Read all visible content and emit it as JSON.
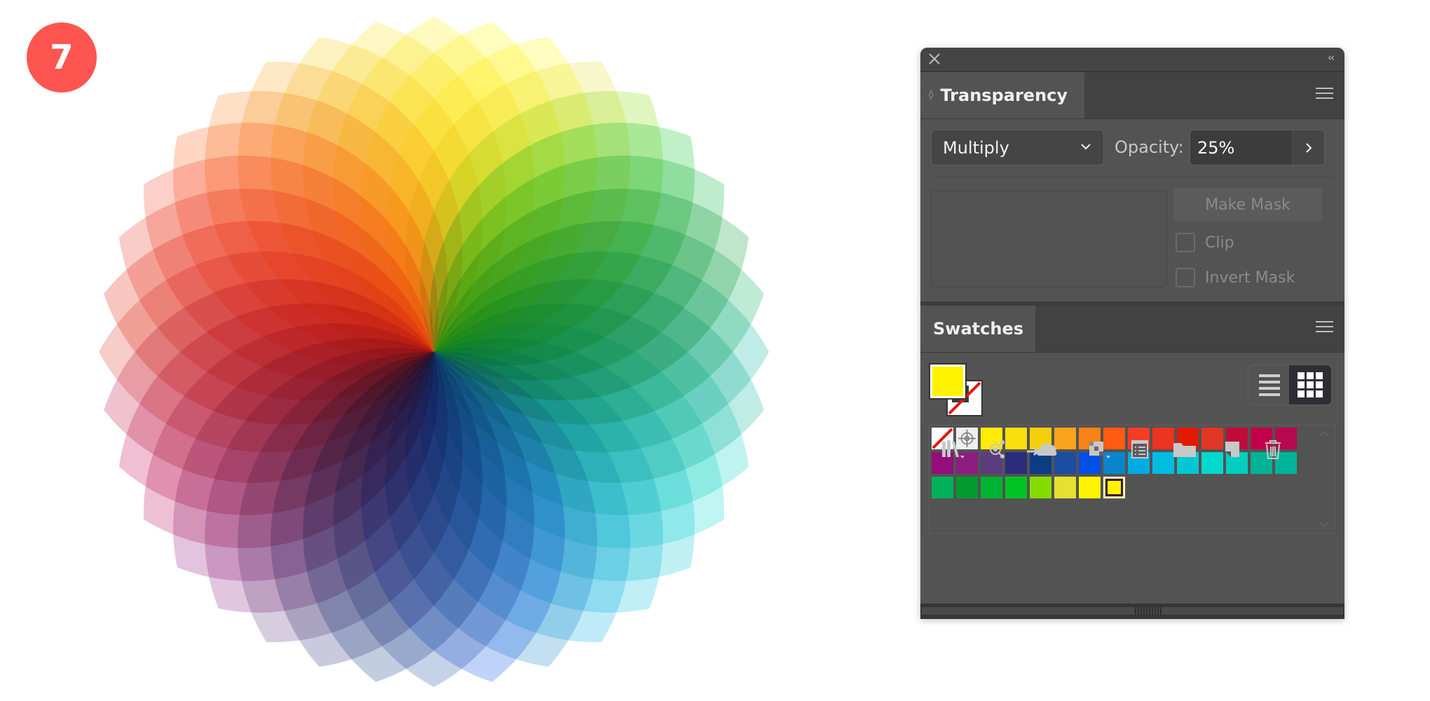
{
  "step_badge": {
    "number": "7",
    "color": "#fe5551"
  },
  "wheel": {
    "petal_count": 36,
    "blend_mode": "multiply",
    "opacity": 0.25
  },
  "panel": {
    "close_icon": "close-icon",
    "collapse_icon": "double-chevron-left-icon",
    "transparency": {
      "tab_label": "Transparency",
      "blend_mode": "Multiply",
      "opacity_label": "Opacity:",
      "opacity_value": "25%",
      "make_mask_label": "Make Mask",
      "clip_label": "Clip",
      "clip_checked": false,
      "invert_mask_label": "Invert Mask",
      "invert_mask_checked": false
    },
    "swatches": {
      "tab_label": "Swatches",
      "fill_color": "#fff200",
      "stroke": "none",
      "view_mode": "grid",
      "items": [
        {
          "type": "none",
          "name": "[None]"
        },
        {
          "type": "registration",
          "name": "[Registration]"
        },
        {
          "type": "color",
          "color": "#ffec00"
        },
        {
          "type": "color",
          "color": "#f9de10"
        },
        {
          "type": "color",
          "color": "#f6cf0b"
        },
        {
          "type": "color",
          "color": "#fba41b"
        },
        {
          "type": "color",
          "color": "#f98316"
        },
        {
          "type": "color",
          "color": "#fe5a12"
        },
        {
          "type": "color",
          "color": "#f33e23"
        },
        {
          "type": "color",
          "color": "#ed3321"
        },
        {
          "type": "color",
          "color": "#e21b00"
        },
        {
          "type": "color",
          "color": "#e13526"
        },
        {
          "type": "color",
          "color": "#c00c3d"
        },
        {
          "type": "color",
          "color": "#c20049"
        },
        {
          "type": "color",
          "color": "#b6084f"
        },
        {
          "type": "color",
          "color": "#930e7b"
        },
        {
          "type": "color",
          "color": "#8d1c80"
        },
        {
          "type": "color",
          "color": "#5c3d7d"
        },
        {
          "type": "color",
          "color": "#2b2d7a"
        },
        {
          "type": "color",
          "color": "#0a3d84"
        },
        {
          "type": "color",
          "color": "#1b4da0"
        },
        {
          "type": "color",
          "color": "#0050e6"
        },
        {
          "type": "color",
          "color": "#0c84cc"
        },
        {
          "type": "color",
          "color": "#00abe3"
        },
        {
          "type": "color",
          "color": "#00bce0"
        },
        {
          "type": "color",
          "color": "#00c8d3"
        },
        {
          "type": "color",
          "color": "#00d8ce"
        },
        {
          "type": "color",
          "color": "#00cebe"
        },
        {
          "type": "color",
          "color": "#00b396"
        },
        {
          "type": "color",
          "color": "#00b49a"
        },
        {
          "type": "color",
          "color": "#00b05a"
        },
        {
          "type": "color",
          "color": "#009a2e"
        },
        {
          "type": "color",
          "color": "#00b332"
        },
        {
          "type": "color",
          "color": "#00c423"
        },
        {
          "type": "color",
          "color": "#85dd00"
        },
        {
          "type": "color",
          "color": "#e4e130"
        },
        {
          "type": "color",
          "color": "#fff200"
        },
        {
          "type": "color",
          "color": "#fff200",
          "selected": true
        }
      ]
    },
    "toolbar": [
      {
        "icon": "swatch-libraries-icon",
        "label": "Swatch Libraries menu",
        "has_menu": true
      },
      {
        "icon": "share-icon",
        "label": "Share"
      },
      {
        "icon": "add-to-cloud-library-icon",
        "label": "Add selected swatches to library"
      },
      {
        "icon": "swatch-kind-icon",
        "label": "Show Swatch Kinds menu",
        "has_menu": true
      },
      {
        "icon": "swatch-options-icon",
        "label": "Swatch Options"
      },
      {
        "icon": "new-color-group-icon",
        "label": "New Color Group"
      },
      {
        "icon": "new-swatch-icon",
        "label": "New Swatch"
      },
      {
        "icon": "delete-icon",
        "label": "Delete Swatch"
      }
    ]
  }
}
